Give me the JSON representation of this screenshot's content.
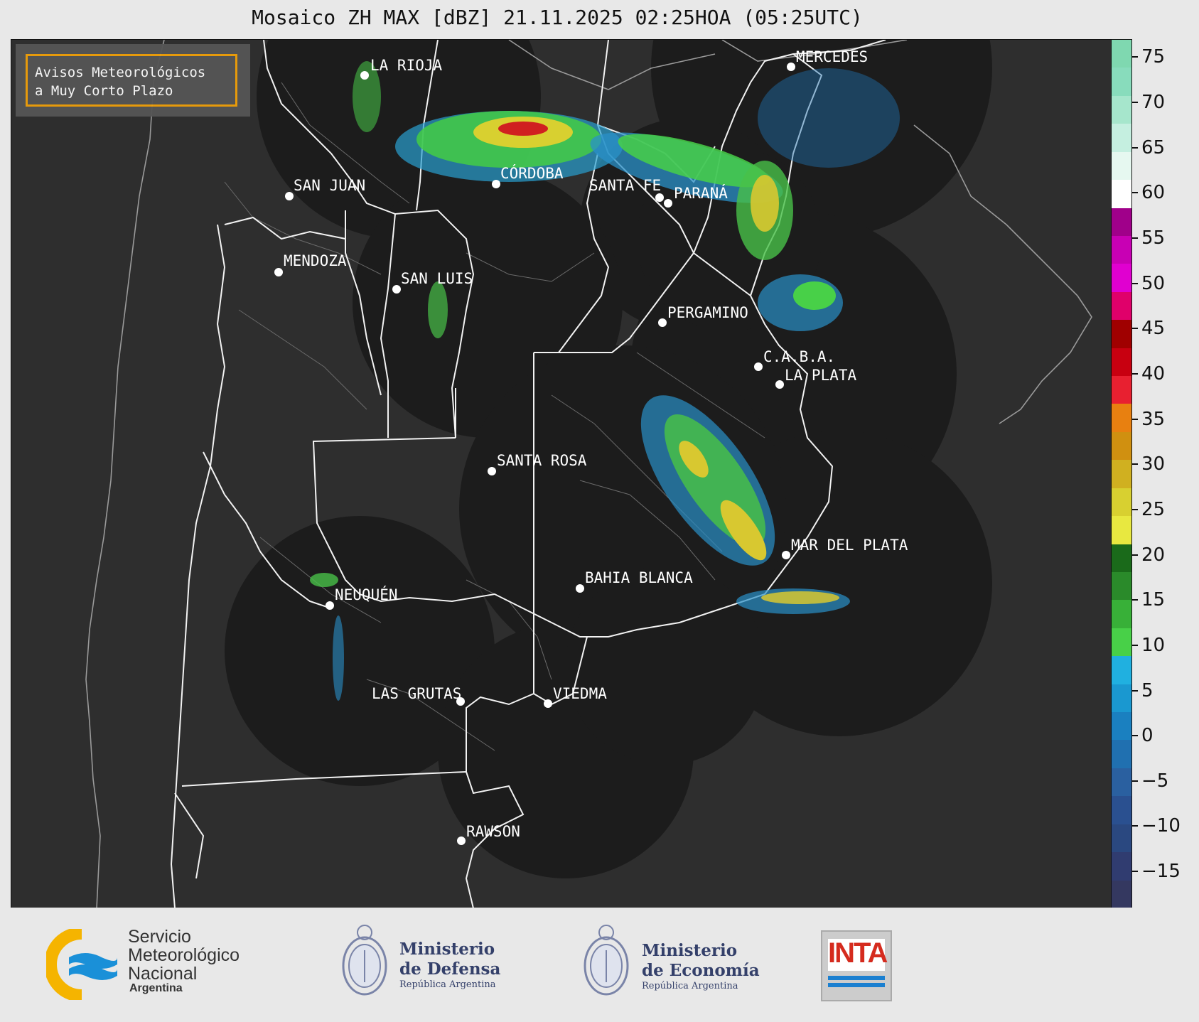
{
  "title": "Mosaico ZH MAX [dBZ] 21.11.2025 02:25HOA (05:25UTC)",
  "notice": {
    "line1": "Avisos Meteorológicos",
    "line2": "a Muy Corto Plazo",
    "border_color": "#f0a00a"
  },
  "cities": [
    {
      "name": "LA RIOJA"
    },
    {
      "name": "MERCEDES"
    },
    {
      "name": "SAN JUAN"
    },
    {
      "name": "CÓRDOBA"
    },
    {
      "name": "SANTA FE"
    },
    {
      "name": "PARANÁ"
    },
    {
      "name": "MENDOZA"
    },
    {
      "name": "SAN LUIS"
    },
    {
      "name": "PERGAMINO"
    },
    {
      "name": "C.A.B.A."
    },
    {
      "name": "LA PLATA"
    },
    {
      "name": "SANTA ROSA"
    },
    {
      "name": "MAR DEL PLATA"
    },
    {
      "name": "BAHIA BLANCA"
    },
    {
      "name": "NEUQUÉN"
    },
    {
      "name": "LAS GRUTAS"
    },
    {
      "name": "VIEDMA"
    },
    {
      "name": "RAWSON"
    }
  ],
  "colorbar": {
    "min": -19,
    "max": 77,
    "ticks": [
      "75",
      "70",
      "65",
      "60",
      "55",
      "50",
      "45",
      "40",
      "35",
      "30",
      "25",
      "20",
      "15",
      "10",
      "5",
      "0",
      "−5",
      "−10",
      "−15"
    ],
    "tick_values": [
      75,
      70,
      65,
      60,
      55,
      50,
      45,
      40,
      35,
      30,
      25,
      20,
      15,
      10,
      5,
      0,
      -5,
      -10,
      -15
    ],
    "colors": [
      "#7fd8b0",
      "#88dcbc",
      "#a6e6cc",
      "#c5efe0",
      "#e6f8f0",
      "#ffffff",
      "#a0008a",
      "#c800b4",
      "#e000d0",
      "#e0006a",
      "#a00000",
      "#c80010",
      "#e82030",
      "#e88010",
      "#d09010",
      "#d0b020",
      "#d8d030",
      "#e8e840",
      "#1a6a1a",
      "#2a8a2a",
      "#38b038",
      "#48d048",
      "#20b0e0",
      "#1a98d0",
      "#1a80c0",
      "#2070b0",
      "#2a60a0",
      "#2a5090",
      "#2a4880",
      "#303c70",
      "#343860"
    ]
  },
  "footer": {
    "smn_line1": "Servicio",
    "smn_line2": "Meteorológico",
    "smn_line3": "Nacional",
    "smn_country": "Argentina",
    "defensa_1": "Ministerio",
    "defensa_2": "de Defensa",
    "defensa_sub": "República Argentina",
    "economia_1": "Ministerio",
    "economia_2": "de Economía",
    "economia_sub": "República Argentina",
    "inta": "INTA"
  }
}
